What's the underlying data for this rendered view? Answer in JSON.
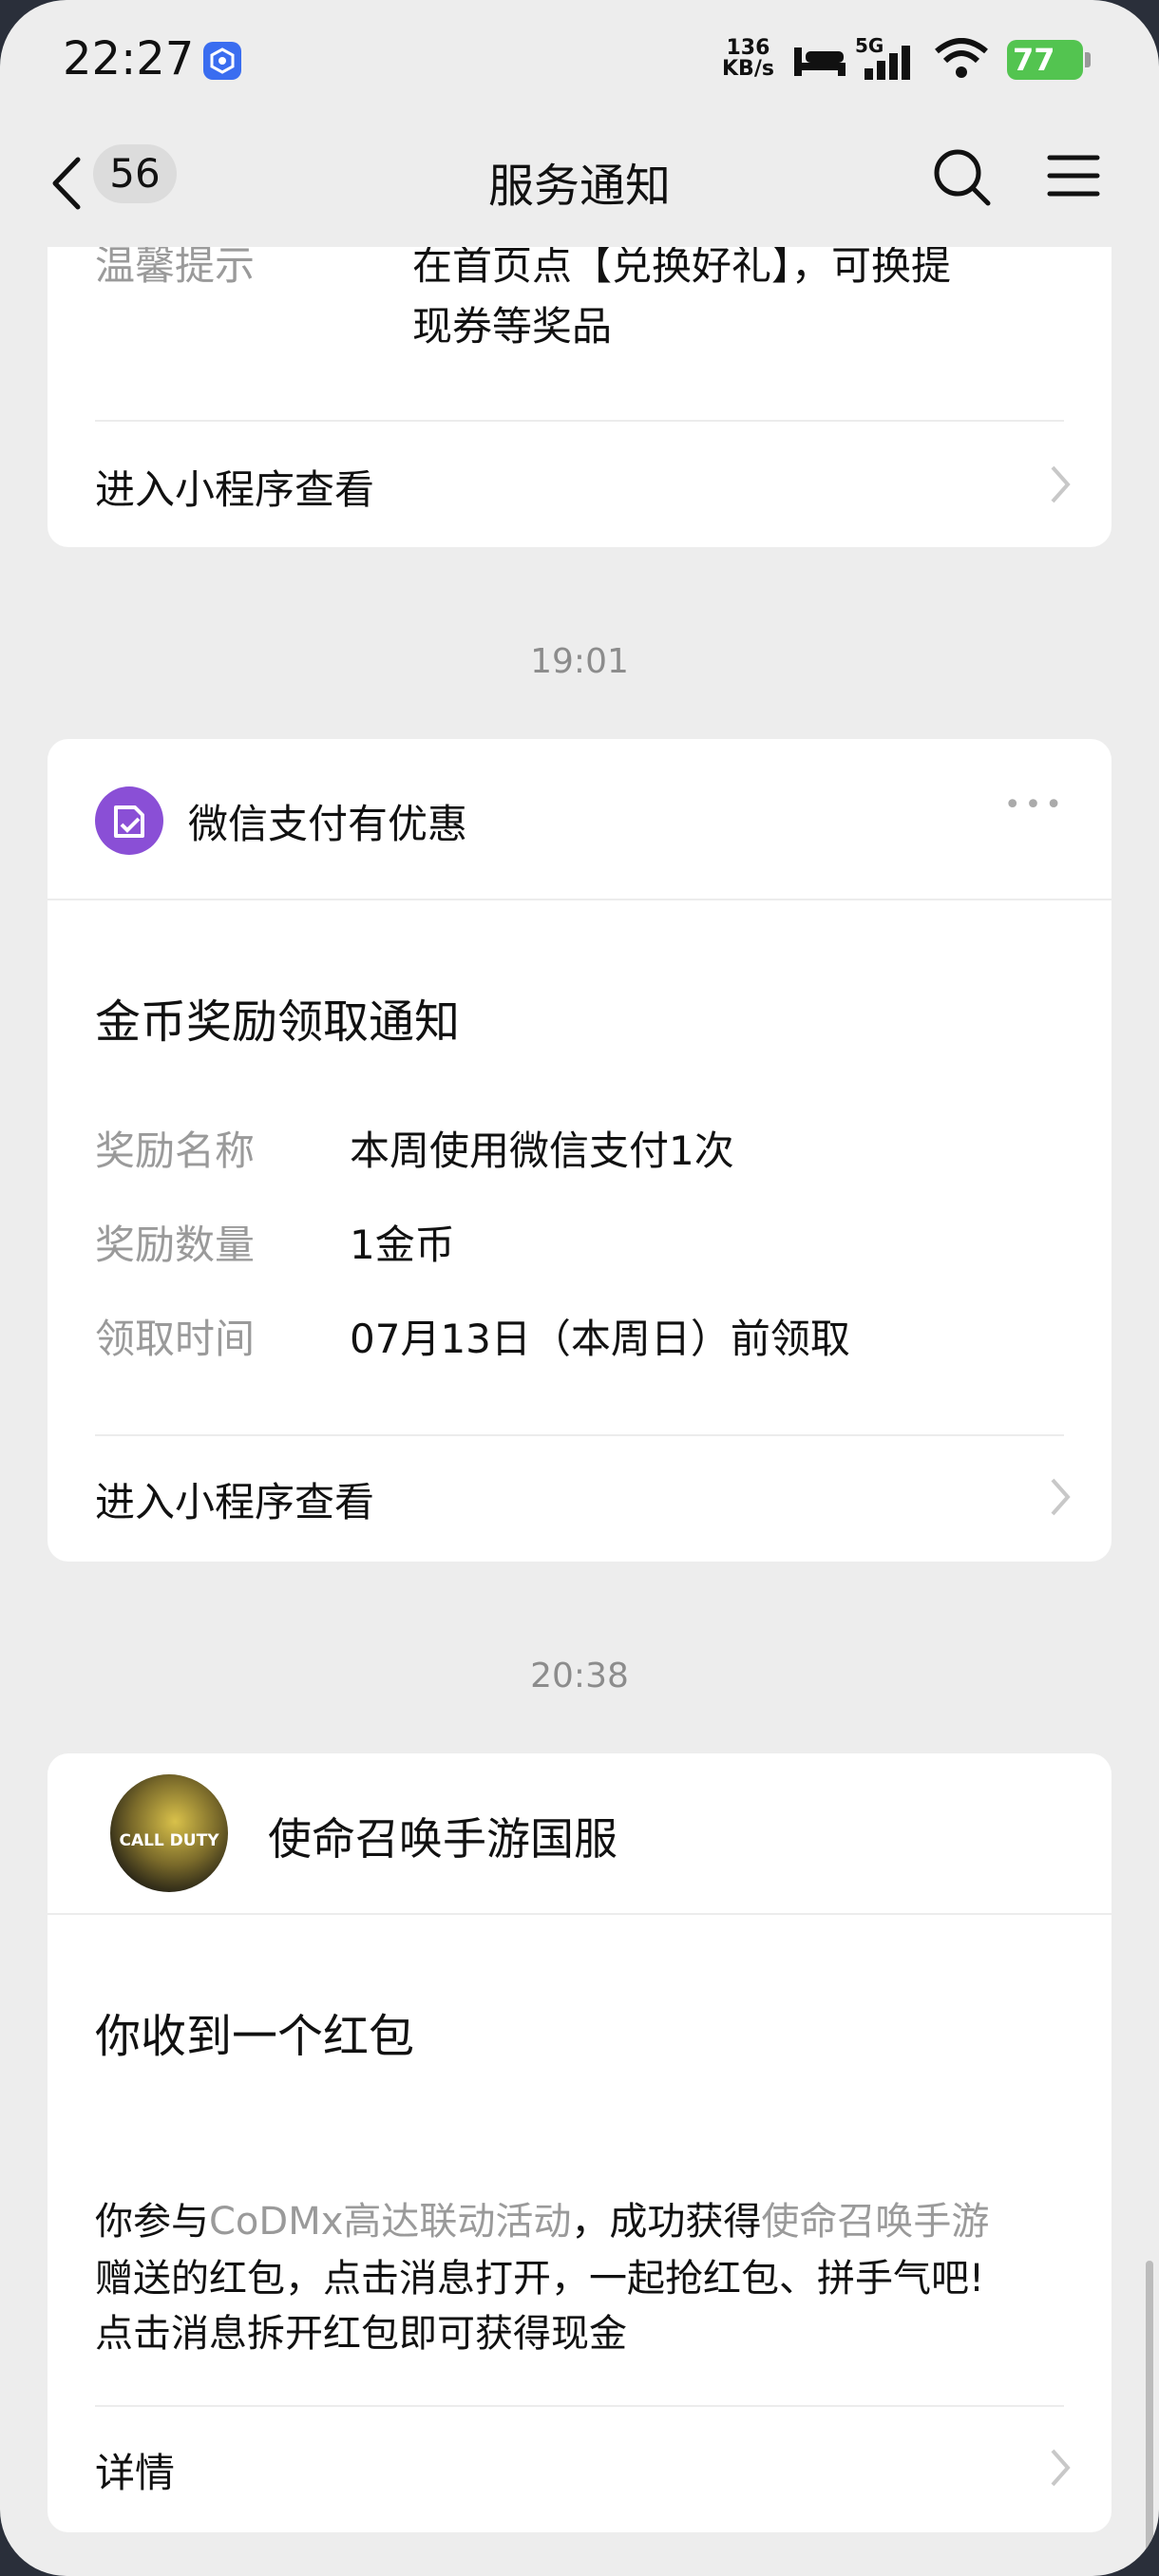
{
  "status_bar": {
    "time": "22:27",
    "net_speed_value": "136",
    "net_speed_unit": "KB/s",
    "network": "5G",
    "battery": "77"
  },
  "nav": {
    "back_count": "56",
    "title": "服务通知",
    "icons": [
      "chevron-left-icon",
      "search-icon",
      "menu-icon"
    ]
  },
  "card1": {
    "label": "温馨提示",
    "value_line1": "在首页点【兑换好礼】，可换提",
    "value_line2": "现券等奖品",
    "link": "进入小程序查看"
  },
  "timestamp1": "19:01",
  "card2": {
    "sender": "微信支付有优惠",
    "more": "•••",
    "headline": "金币奖励领取通知",
    "rows": [
      {
        "label": "奖励名称",
        "value": "本周使用微信支付1次"
      },
      {
        "label": "奖励数量",
        "value": "1金币"
      },
      {
        "label": "领取时间",
        "value": "07月13日（本周日）前领取"
      }
    ],
    "link": "进入小程序查看"
  },
  "timestamp2": "20:38",
  "card3": {
    "sender": "使命召唤手游国服",
    "avatar_text": "CALL DUTY",
    "headline": "你收到一个红包",
    "body_p1": "你参与",
    "body_highlight1": "CoDMx高达联动活动",
    "body_p2": "，成功获得",
    "body_highlight2": "使命召唤手游",
    "body_line2": "赠送的红包，点击消息打开，一起抢红包、拼手气吧!",
    "body_line3": "点击消息拆开红包即可获得现金",
    "link": "详情"
  },
  "colors": {
    "background": "#ededed",
    "card": "#ffffff",
    "wechat_pay_icon": "#8a4fd6",
    "battery": "#53c450"
  }
}
